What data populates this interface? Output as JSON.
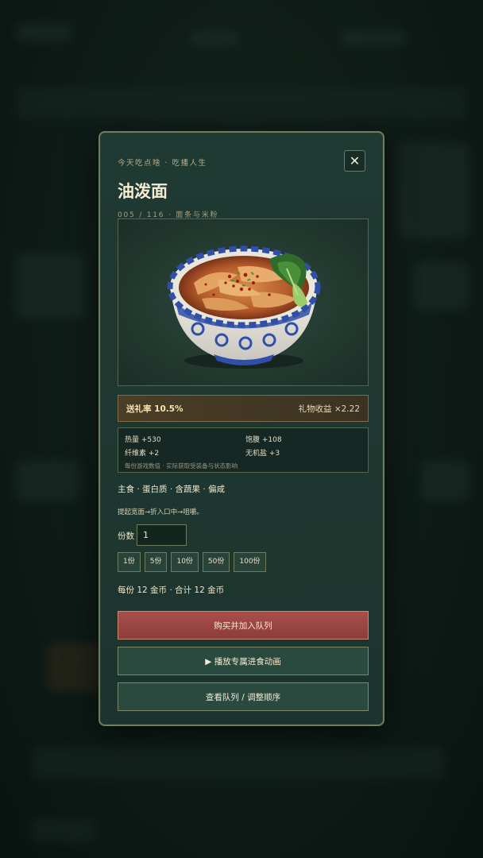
{
  "modal": {
    "subtitle": "今天吃点啥 · 吃播人生",
    "close_icon": "✕",
    "title": "油泼面",
    "meta": "005 / 116 · 面条与米粉"
  },
  "food_image": {
    "icon": "noodle-bowl-illustration"
  },
  "rate_bar": {
    "left": "送礼率 10.5%",
    "right": "礼物收益 ×2.22"
  },
  "stats": {
    "items": [
      "热量 +530",
      "饱腹 +108",
      "纤维素 +2",
      "无机盐 +3"
    ],
    "note": "每份游戏数值 · 实际获取受装备与状态影响"
  },
  "tags": "主食 · 蛋白质 · 含蔬果 · 偏咸",
  "description": "提起宽面→折入口中→咀嚼。",
  "quantity": {
    "label": "份数",
    "value": "1",
    "chips": [
      "1份",
      "5份",
      "10份",
      "50份",
      "100份"
    ]
  },
  "price": "每份 12 金币 · 合计 12 金币",
  "buttons": {
    "buy": "购买并加入队列",
    "play": "▶ 播放专属进食动画",
    "queue": "查看队列 / 调整顺序"
  },
  "colors": {
    "modal_bg": "#1f3a32",
    "border": "#6e7d5e",
    "buy_button": "#a94f4b",
    "rate_bar_bg": "#4a3e26"
  }
}
